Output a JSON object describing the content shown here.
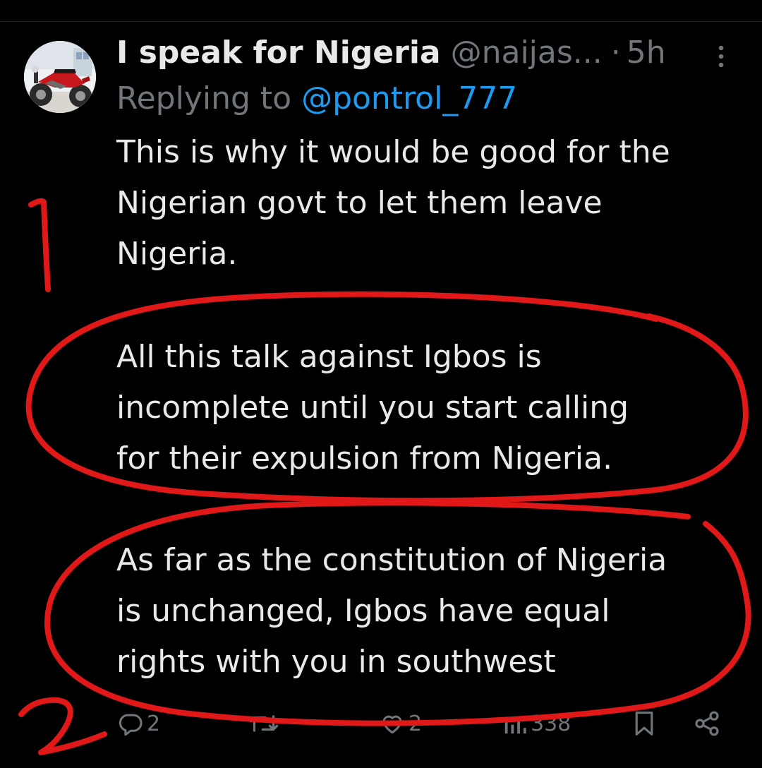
{
  "tweet": {
    "author_name": "I speak for Nigeria",
    "handle": "@naijas...",
    "separator": "·",
    "time": "5h",
    "replying_prefix": "Replying to",
    "replying_to": "@pontrol_777",
    "paragraph1": [
      "This is why it would be good for the",
      "Nigerian govt to let them leave",
      "Nigeria."
    ],
    "paragraph2": [
      "All this talk against Igbos is",
      "incomplete until you start calling",
      "for their expulsion from Nigeria."
    ],
    "paragraph3": [
      "As far as the constitution of Nigeria",
      "is unchanged, Igbos have equal",
      "rights with you in southwest"
    ]
  },
  "actions": {
    "replies": "2",
    "likes": "2",
    "views": "338"
  },
  "icons": {
    "avatar": "motorcycle-photo",
    "more": "more-vertical-icon",
    "reply": "reply-icon",
    "retweet": "retweet-icon",
    "like": "heart-icon",
    "views": "views-icon",
    "bookmark": "bookmark-icon",
    "share": "share-icon"
  },
  "annotations": {
    "mark_1": "1",
    "mark_2": "2",
    "ink_color": "#e01818"
  },
  "colors": {
    "background": "#000000",
    "text": "#e7e9ea",
    "muted": "#71767b",
    "link": "#1d9bf0"
  }
}
